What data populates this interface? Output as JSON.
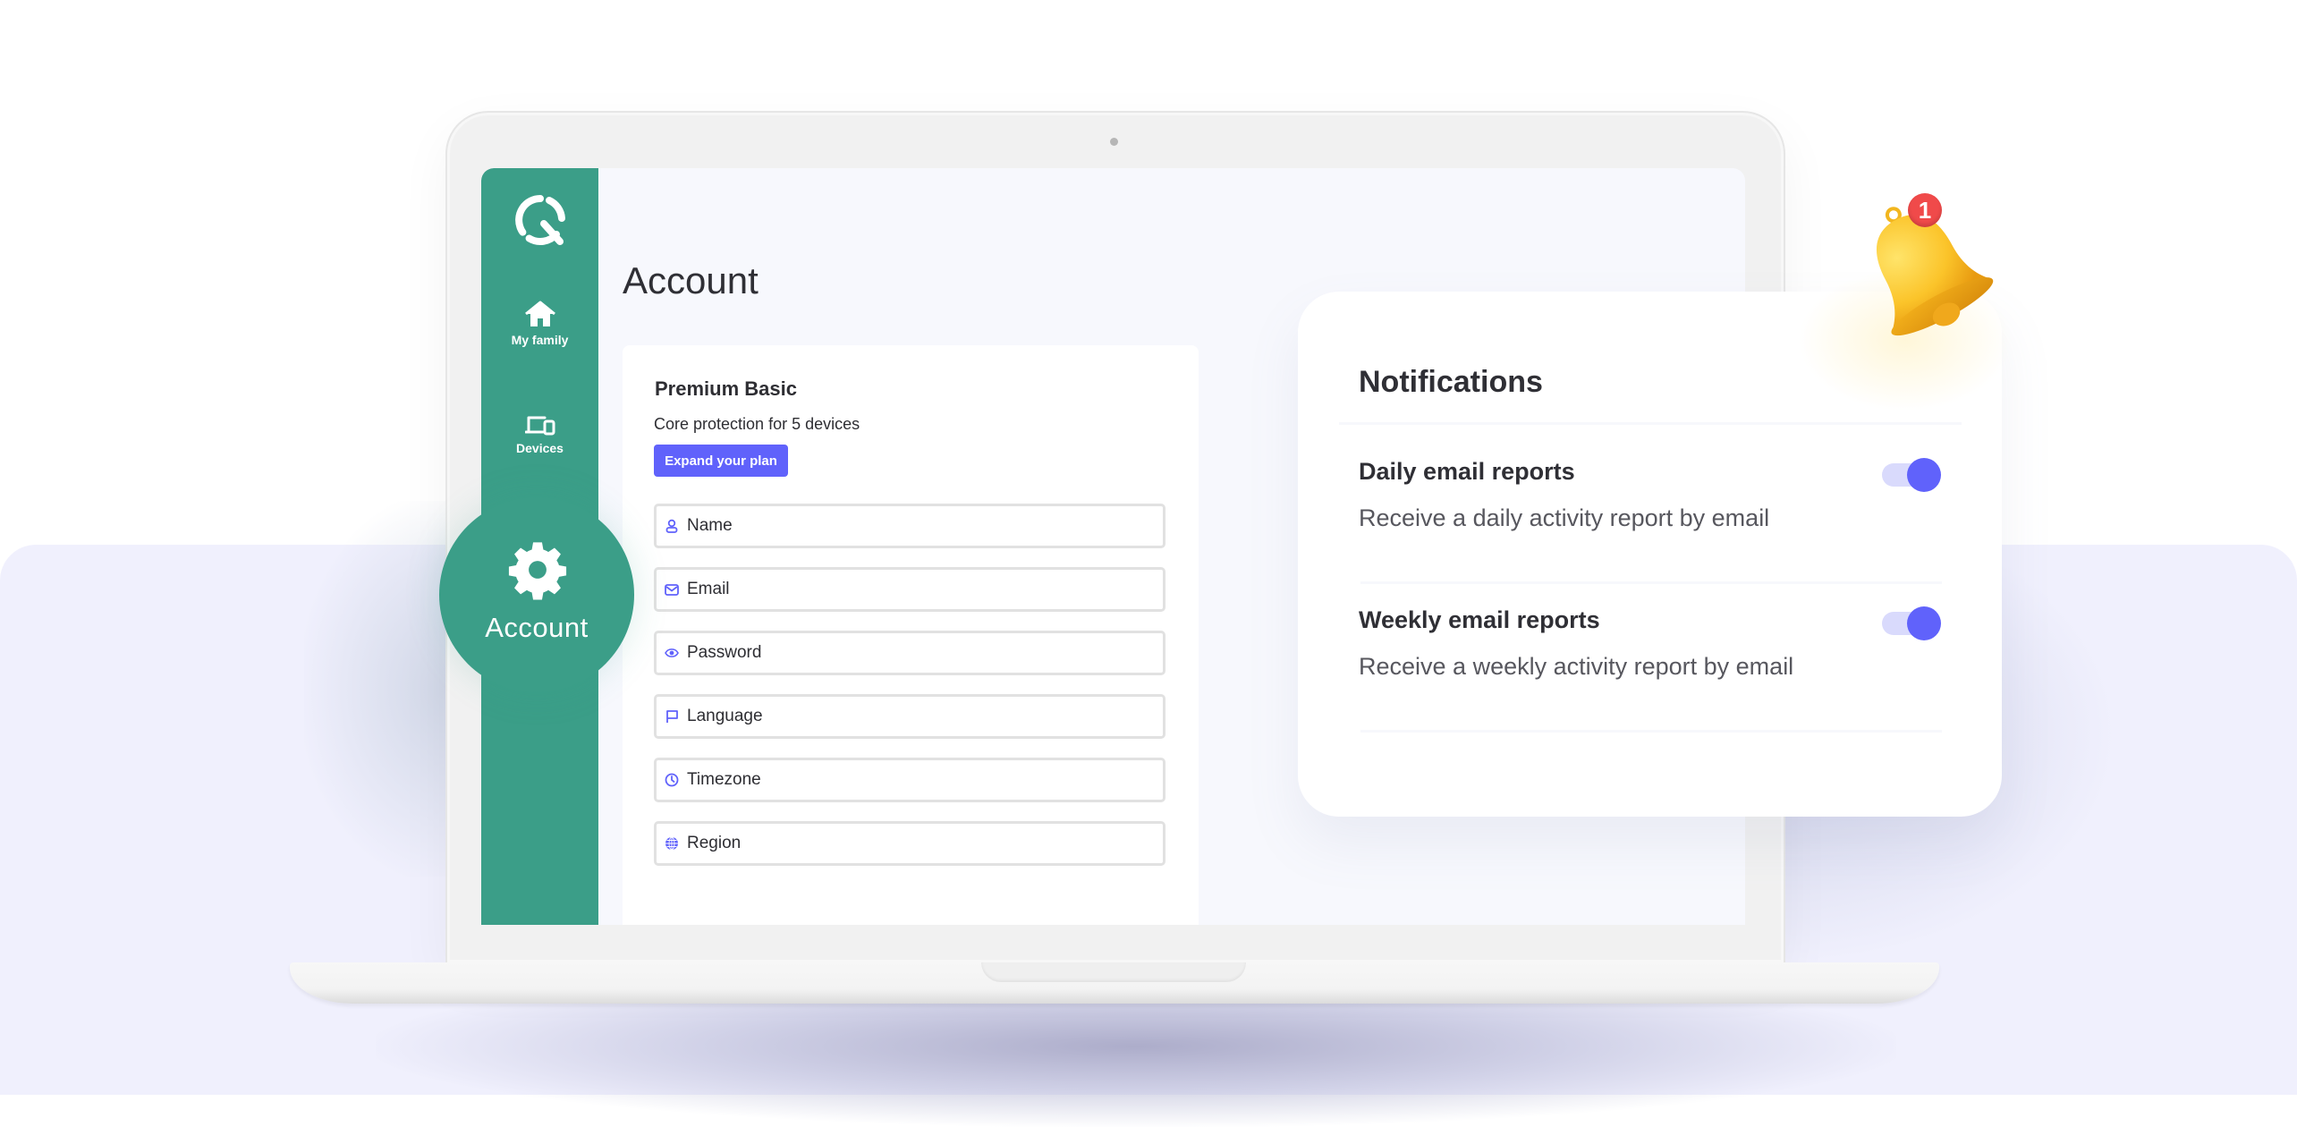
{
  "sidebar": {
    "logo": "q-logo-icon",
    "items": [
      {
        "label": "My family",
        "icon": "home-icon"
      },
      {
        "label": "Devices",
        "icon": "devices-icon"
      },
      {
        "label": "Account",
        "icon": "gear-icon",
        "active": true
      }
    ]
  },
  "main": {
    "title": "Account",
    "plan": {
      "name": "Premium Basic",
      "description": "Core protection for 5 devices",
      "button_label": "Expand your plan"
    },
    "fields": [
      {
        "placeholder": "Name",
        "icon": "user-icon",
        "value": ""
      },
      {
        "placeholder": "Email",
        "icon": "mail-icon",
        "value": ""
      },
      {
        "placeholder": "Password",
        "icon": "eye-icon",
        "value": ""
      },
      {
        "placeholder": "Language",
        "icon": "flag-icon",
        "value": ""
      },
      {
        "placeholder": "Timezone",
        "icon": "clock-icon",
        "value": ""
      },
      {
        "placeholder": "Region",
        "icon": "globe-icon",
        "value": ""
      }
    ]
  },
  "notifications": {
    "title": "Notifications",
    "badge_count": "1",
    "items": [
      {
        "title": "Daily email reports",
        "description": "Receive a daily activity report by email",
        "enabled": true
      },
      {
        "title": "Weekly email reports",
        "description": "Receive a weekly activity report by email",
        "enabled": true
      }
    ]
  },
  "colors": {
    "sidebar": "#3b9e88",
    "accent": "#6062fb",
    "toggle_track": "#d9dafc",
    "badge": "#f04a4a",
    "backdrop": "#f0f0fd"
  }
}
